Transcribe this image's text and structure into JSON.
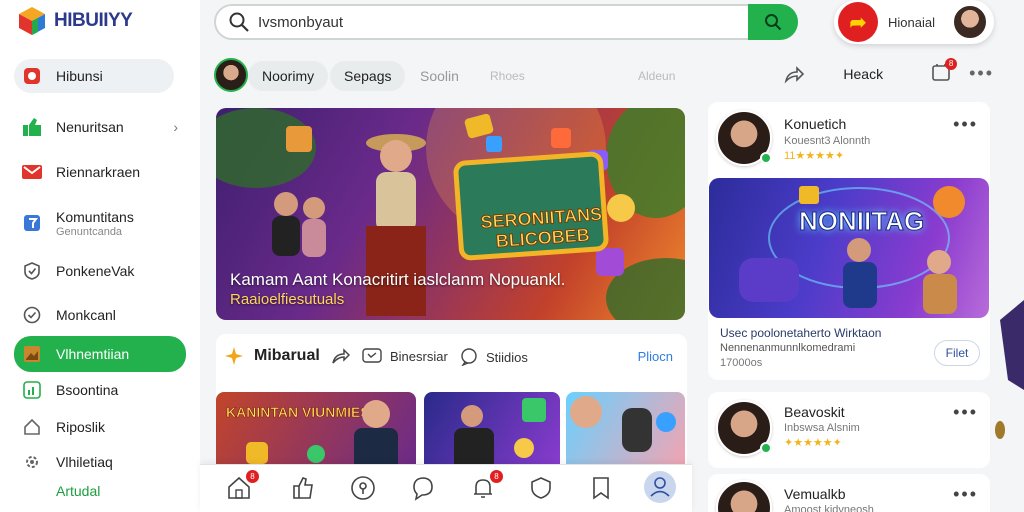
{
  "app": {
    "name": "HIBUIIYY"
  },
  "sidebar": {
    "items": [
      {
        "label": "Hibunsi",
        "icon": "app-icon"
      },
      {
        "label": "Nenuritsan",
        "icon": "thumbs-up-icon"
      },
      {
        "label": "Riennarkraen",
        "icon": "mail-icon"
      },
      {
        "label": "Komuntitans",
        "sub": "Genuntcanda",
        "icon": "flag-icon"
      },
      {
        "label": "PonkeneVak",
        "icon": "check-shield-icon"
      },
      {
        "label": "Monkcanl",
        "icon": "check-circle-icon"
      },
      {
        "label": "Vlhnemtiian",
        "icon": "image-icon"
      },
      {
        "label": "Bsoontina",
        "icon": "chart-icon"
      },
      {
        "label": "Riposlik",
        "icon": "home-icon"
      },
      {
        "label": "Vlhiletiaq",
        "icon": "gear-icon"
      }
    ],
    "footer": "Artudal"
  },
  "search": {
    "value": "Ivsmonbyaut"
  },
  "user": {
    "name": "Hionaial",
    "badge": "➦"
  },
  "tabs": {
    "items": [
      {
        "label": "Noorimy",
        "style": "pill"
      },
      {
        "label": "Sepags",
        "style": "pill"
      },
      {
        "label": "Soolin",
        "style": "muted"
      },
      {
        "label": "Rhoes",
        "style": "faint"
      },
      {
        "label": "Aldeun",
        "style": "faint"
      }
    ],
    "action": "Heack",
    "notif_count": "8"
  },
  "hero": {
    "board_title": "SERONIITANS BLICOBEB",
    "caption": "Kamam Aant Konacritirt iaslclanm Nopuankl.",
    "subcaption": "Raaioelfiesutuals"
  },
  "section": {
    "title": "Mibarual",
    "tab1": "Binesrsiar",
    "tab2": "Stiidios",
    "link": "Pliocn",
    "thumb_title": "KANINTAN VIUNMIES"
  },
  "bottom_nav": {
    "badge1": "8",
    "badge2": "8"
  },
  "right": {
    "card1": {
      "name": "Konuetich",
      "meta": "Kouesnt3 Alonnth",
      "stars": "11★★★★✦"
    },
    "promo": {
      "title": "NONIITAG",
      "line1": "Usec poolonetaherto Wirktaon",
      "line2": "Nennenanmunnlkomedrami",
      "line3": "17000os",
      "button": "Filet"
    },
    "card2": {
      "name": "Beavoskit",
      "meta": "Inbswsa Alsnim",
      "stars": "✦★★★★✦"
    },
    "card3": {
      "name": "Vemualkb",
      "meta": "Amoost kidvneosh"
    }
  },
  "colors": {
    "accent": "#22b14c",
    "danger": "#e02020",
    "brand": "#2d3a8c",
    "link": "#2f7de1"
  }
}
